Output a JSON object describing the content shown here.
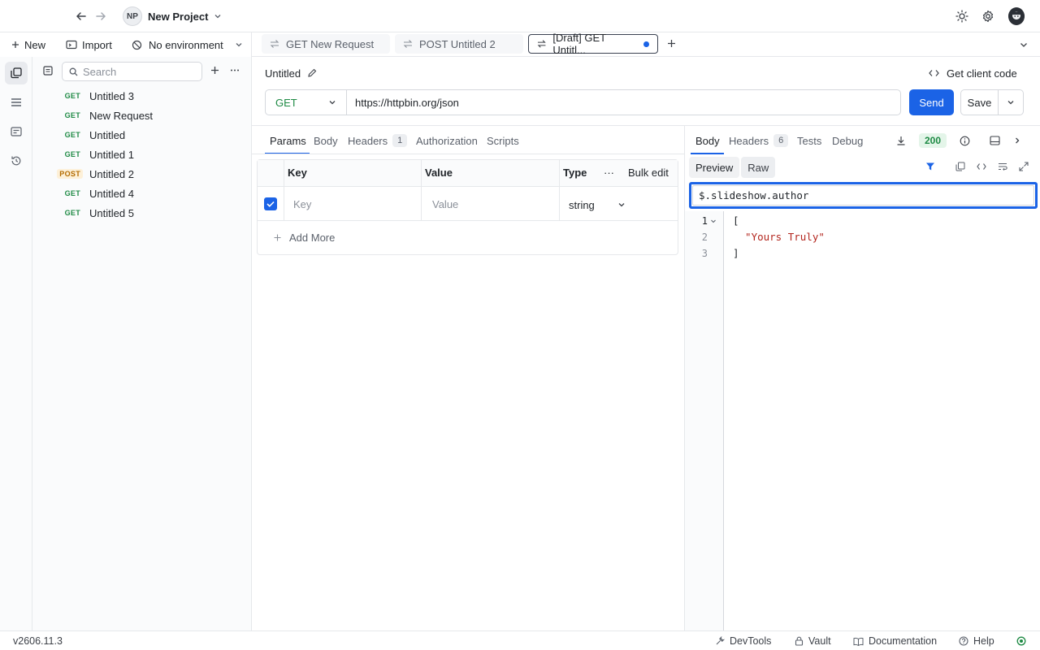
{
  "topbar": {
    "project_initials": "NP",
    "project_name": "New Project"
  },
  "sidebar_actions": {
    "new_label": "New",
    "import_label": "Import",
    "environment_label": "No environment"
  },
  "sidebar": {
    "search_placeholder": "Search",
    "requests": [
      {
        "method": "GET",
        "name": "Untitled 3"
      },
      {
        "method": "GET",
        "name": "New Request"
      },
      {
        "method": "GET",
        "name": "Untitled"
      },
      {
        "method": "GET",
        "name": "Untitled 1"
      },
      {
        "method": "POST",
        "name": "Untitled 2"
      },
      {
        "method": "GET",
        "name": "Untitled 4"
      },
      {
        "method": "GET",
        "name": "Untitled 5"
      }
    ]
  },
  "tabs": [
    {
      "label": "GET New Request"
    },
    {
      "label": "POST Untitled 2"
    },
    {
      "label": "[Draft] GET Untitl..."
    }
  ],
  "request": {
    "title": "Untitled",
    "client_code_label": "Get client code",
    "method": "GET",
    "url": "https://httpbin.org/json",
    "send_label": "Send",
    "save_label": "Save"
  },
  "request_tabs": {
    "params": "Params",
    "body": "Body",
    "headers": "Headers",
    "headers_count": "1",
    "authorization": "Authorization",
    "scripts": "Scripts"
  },
  "params_table": {
    "col_key": "Key",
    "col_value": "Value",
    "col_type": "Type",
    "more": "···",
    "bulk_edit": "Bulk edit",
    "key_placeholder": "Key",
    "value_placeholder": "Value",
    "type_value": "string",
    "add_more": "Add More"
  },
  "response": {
    "tab_body": "Body",
    "tab_headers": "Headers",
    "headers_count": "6",
    "tab_tests": "Tests",
    "tab_debug": "Debug",
    "status": "200",
    "view_preview": "Preview",
    "view_raw": "Raw",
    "filter_value": "$.slideshow.author",
    "line_numbers": [
      "1",
      "2",
      "3"
    ],
    "code_lines": [
      "[",
      "  \"Yours Truly\"",
      "]"
    ]
  },
  "statusbar": {
    "version": "v2606.11.3",
    "devtools": "DevTools",
    "vault": "Vault",
    "documentation": "Documentation",
    "help": "Help"
  },
  "colors": {
    "accent": "#1b63e6",
    "get_method": "#1e8a44",
    "post_method": "#b36b00",
    "json_string": "#b3261e"
  }
}
